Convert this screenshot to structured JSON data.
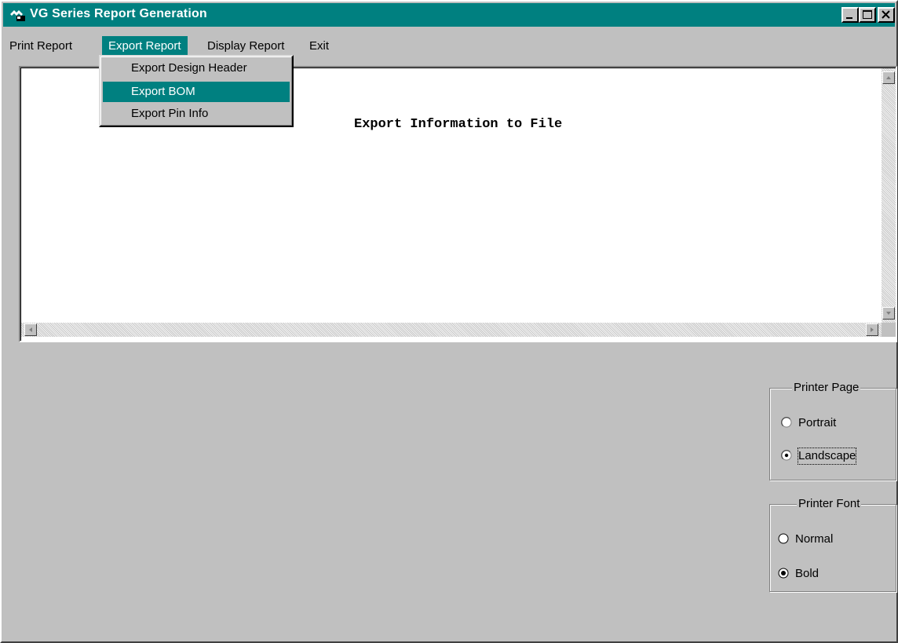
{
  "window": {
    "title": "VG Series Report Generation",
    "accent_color": "#008080",
    "icons": {
      "app": "app-logo-icon",
      "minimize": "minimize-icon",
      "maximize": "maximize-icon",
      "close": "close-icon"
    }
  },
  "menubar": {
    "items": [
      {
        "label": "Print Report"
      },
      {
        "label": "Export Report",
        "active": true
      },
      {
        "label": "Display Report"
      },
      {
        "label": "Exit"
      }
    ]
  },
  "dropdown": {
    "items": [
      {
        "label": "Export Design Header"
      },
      {
        "label": "Export BOM",
        "highlighted": true
      },
      {
        "label": "Export Pin Info"
      }
    ]
  },
  "content": {
    "text": "Export Information to File"
  },
  "printer_page": {
    "title": "Printer Page",
    "options": [
      {
        "label": "Portrait",
        "selected": false
      },
      {
        "label": "Landscape",
        "selected": true
      }
    ]
  },
  "printer_font": {
    "title": "Printer Font",
    "options": [
      {
        "label": "Normal",
        "selected": false
      },
      {
        "label": "Bold",
        "selected": true
      }
    ]
  }
}
